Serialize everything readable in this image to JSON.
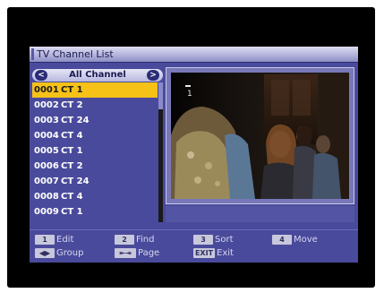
{
  "window": {
    "title": "TV Channel List"
  },
  "group": {
    "label": "All Channel",
    "prev_glyph": "<",
    "next_glyph": ">"
  },
  "channels": [
    {
      "number": "0001",
      "name": "CT 1",
      "selected": true
    },
    {
      "number": "0002",
      "name": "CT 2",
      "selected": false
    },
    {
      "number": "0003",
      "name": "CT 24",
      "selected": false
    },
    {
      "number": "0004",
      "name": "CT 4",
      "selected": false
    },
    {
      "number": "0005",
      "name": "CT 1",
      "selected": false
    },
    {
      "number": "0006",
      "name": "CT 2",
      "selected": false
    },
    {
      "number": "0007",
      "name": "CT 24",
      "selected": false
    },
    {
      "number": "0008",
      "name": "CT 4",
      "selected": false
    },
    {
      "number": "0009",
      "name": "CT 1",
      "selected": false
    }
  ],
  "preview": {
    "channel_badge": "1"
  },
  "footer": {
    "edit": {
      "key": "1",
      "label": "Edit"
    },
    "find": {
      "key": "2",
      "label": "Find"
    },
    "sort": {
      "key": "3",
      "label": "Sort"
    },
    "move": {
      "key": "4",
      "label": "Move"
    },
    "group": {
      "key": "◀▶",
      "label": "Group"
    },
    "page": {
      "key": "⇤⇥",
      "label": "Page"
    },
    "exit": {
      "key": "EXIT",
      "label": "Exit"
    }
  },
  "colors": {
    "panel_bg": "#4a4a9c",
    "selection": "#f6c218",
    "title_text": "#1a1a50"
  }
}
